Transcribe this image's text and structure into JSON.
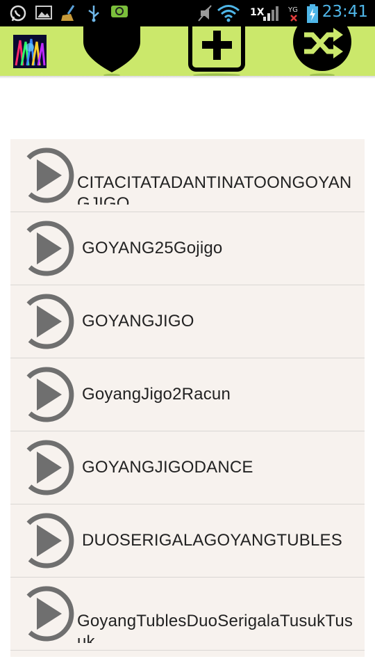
{
  "status_bar": {
    "time": "23:41",
    "network_label": "1X",
    "notification_icons": [
      "whatsapp-icon",
      "gallery-icon",
      "cleaner-icon",
      "usb-icon",
      "sms-icon"
    ],
    "system_icons": [
      "mute-icon",
      "wifi-icon",
      "signal-icon",
      "no-sim-icon",
      "battery-charging-icon"
    ]
  },
  "action_bar": {
    "background_color": "#cbe86b",
    "logo": "app-logo",
    "actions": [
      "favorite-heart-icon",
      "add-playlist-icon",
      "shuffle-icon"
    ]
  },
  "playlist": {
    "items": [
      {
        "title": "CITACITATADANTINATOONGOYANGJIGO"
      },
      {
        "title": "GOYANG25Gojigo"
      },
      {
        "title": "GOYANGJIGO"
      },
      {
        "title": "GoyangJigo2Racun"
      },
      {
        "title": "GOYANGJIGODANCE"
      },
      {
        "title": "DUOSERIGALAGOYANGTUBLES"
      },
      {
        "title": "GoyangTublesDuoSerigalaTusukTusuk"
      }
    ]
  }
}
